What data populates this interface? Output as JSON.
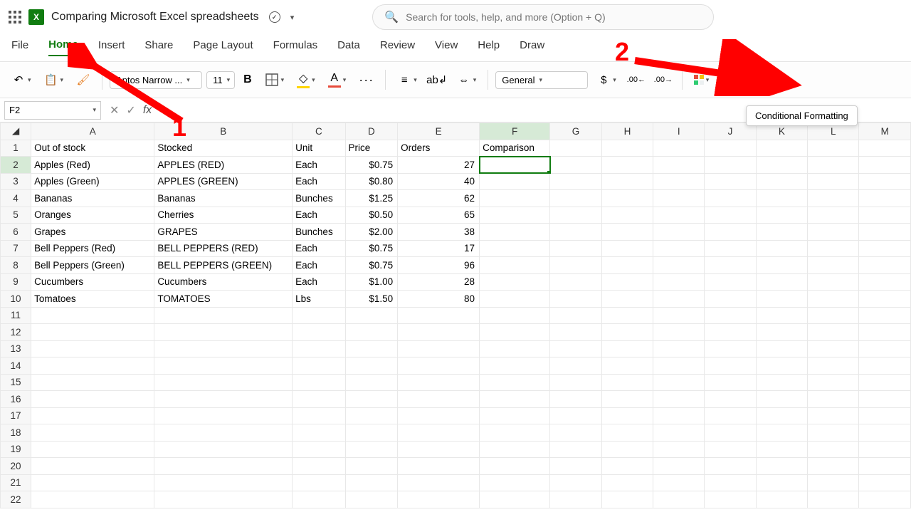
{
  "title": "Comparing Microsoft Excel spreadsheets",
  "search_placeholder": "Search for tools, help, and more (Option + Q)",
  "tabs": [
    "File",
    "Home",
    "Insert",
    "Share",
    "Page Layout",
    "Formulas",
    "Data",
    "Review",
    "View",
    "Help",
    "Draw"
  ],
  "active_tab": "Home",
  "ribbon": {
    "font_name": "Aptos Narrow ...",
    "font_size": "11",
    "number_format": "General",
    "dollar": "$",
    "decimals": ".00",
    "bold": "B",
    "font_a": "A"
  },
  "name_box": "F2",
  "tooltip": "Conditional Formatting",
  "annotations": {
    "a1": "1",
    "a2": "2"
  },
  "columns": [
    "A",
    "B",
    "C",
    "D",
    "E",
    "F",
    "G",
    "H",
    "I",
    "J",
    "K",
    "L",
    "M"
  ],
  "active_col_index": 5,
  "active_row": 2,
  "headers": {
    "A": "Out of stock",
    "B": "Stocked",
    "C": "Unit",
    "D": "Price",
    "E": "Orders",
    "F": "Comparison"
  },
  "rows": [
    {
      "A": "Apples (Red)",
      "B": "APPLES (RED)",
      "C": "Each",
      "D": "$0.75",
      "E": "27"
    },
    {
      "A": "Apples (Green)",
      "B": "APPLES (GREEN)",
      "C": "Each",
      "D": "$0.80",
      "E": "40"
    },
    {
      "A": "Bananas",
      "B": "Bananas",
      "C": "Bunches",
      "D": "$1.25",
      "E": "62"
    },
    {
      "A": "Oranges",
      "B": "Cherries",
      "C": "Each",
      "D": "$0.50",
      "E": "65"
    },
    {
      "A": "Grapes",
      "B": "GRAPES",
      "C": "Bunches",
      "D": "$2.00",
      "E": "38"
    },
    {
      "A": "Bell Peppers (Red)",
      "B": "BELL PEPPERS (RED)",
      "C": "Each",
      "D": "$0.75",
      "E": "17"
    },
    {
      "A": "Bell Peppers (Green)",
      "B": "BELL PEPPERS (GREEN)",
      "C": "Each",
      "D": "$0.75",
      "E": "96"
    },
    {
      "A": "Cucumbers",
      "B": "Cucumbers",
      "C": "Each",
      "D": "$1.00",
      "E": "28"
    },
    {
      "A": "Tomatoes",
      "B": "TOMATOES",
      "C": "Lbs",
      "D": "$1.50",
      "E": "80"
    }
  ],
  "total_rows": 22
}
